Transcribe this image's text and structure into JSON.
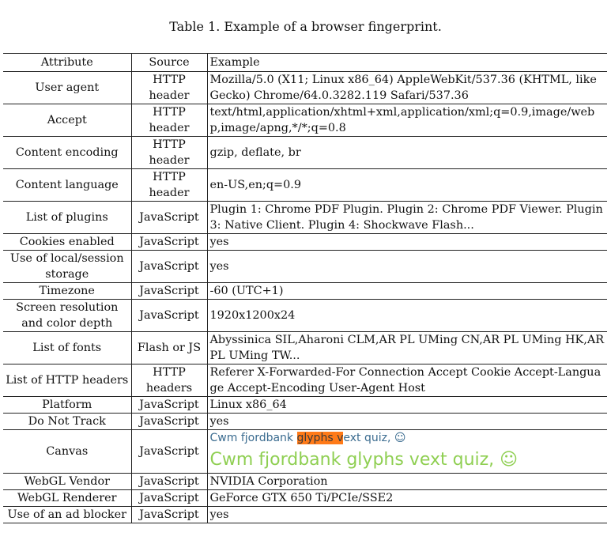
{
  "caption": "Table 1.  Example of a browser fingerprint.",
  "headers": {
    "attribute": "Attribute",
    "source": "Source",
    "example": "Example"
  },
  "rows": [
    {
      "attribute": "User agent",
      "source": "HTTP header",
      "example": "Mozilla/5.0 (X11; Linux x86_64) AppleWebKit/537.36 (KHTML, like Gecko) Chrome/64.0.3282.119 Safari/537.36"
    },
    {
      "attribute": "Accept",
      "source": "HTTP header",
      "example": "text/html,application/xhtml+xml,application/xml;q=0.9,image/webp,image/apng,*/*;q=0.8"
    },
    {
      "attribute": "Content encoding",
      "source": "HTTP header",
      "example": "gzip, deflate, br"
    },
    {
      "attribute": "Content language",
      "source": "HTTP header",
      "example": "en-US,en;q=0.9"
    },
    {
      "attribute": "List of plugins",
      "source": "JavaScript",
      "example": "Plugin 1: Chrome PDF Plugin. Plugin 2: Chrome PDF Viewer. Plugin 3: Native Client. Plugin 4: Shockwave Flash..."
    },
    {
      "attribute": "Cookies enabled",
      "source": "JavaScript",
      "example": "yes"
    },
    {
      "attribute": "Use of local/session storage",
      "source": "JavaScript",
      "example": "yes"
    },
    {
      "attribute": "Timezone",
      "source": "JavaScript",
      "example": "-60 (UTC+1)"
    },
    {
      "attribute": "Screen resolution and color depth",
      "source": "JavaScript",
      "example": "1920x1200x24"
    },
    {
      "attribute": "List of fonts",
      "source": "Flash or JS",
      "example": "Abyssinica SIL,Aharoni CLM,AR PL UMing CN,AR PL UMing HK,AR PL UMing TW..."
    },
    {
      "attribute": "List of HTTP headers",
      "source": "HTTP headers",
      "example": "Referer X-Forwarded-For Connection Accept Cookie Accept-Language Accept-Encoding User-Agent Host"
    },
    {
      "attribute": "Platform",
      "source": "JavaScript",
      "example": "Linux x86_64"
    },
    {
      "attribute": "Do Not Track",
      "source": "JavaScript",
      "example": "yes"
    },
    {
      "attribute": "Canvas",
      "source": "JavaScript",
      "canvas": {
        "small_before": "Cwm fjordbank ",
        "small_highlight": "glyphs v",
        "small_after": "ext quiz, ☺",
        "big": "Cwm fjordbank glyphs vext quiz, ☺",
        "small_color": "#3a6b8f",
        "big_color": "#8fcf52",
        "highlight_color": "#ff7a18"
      }
    },
    {
      "attribute": "WebGL Vendor",
      "source": "JavaScript",
      "example": "NVIDIA Corporation"
    },
    {
      "attribute": "WebGL Renderer",
      "source": "JavaScript",
      "example": "GeForce GTX 650 Ti/PCIe/SSE2"
    },
    {
      "attribute": "Use of an ad blocker",
      "source": "JavaScript",
      "example": "yes"
    }
  ]
}
